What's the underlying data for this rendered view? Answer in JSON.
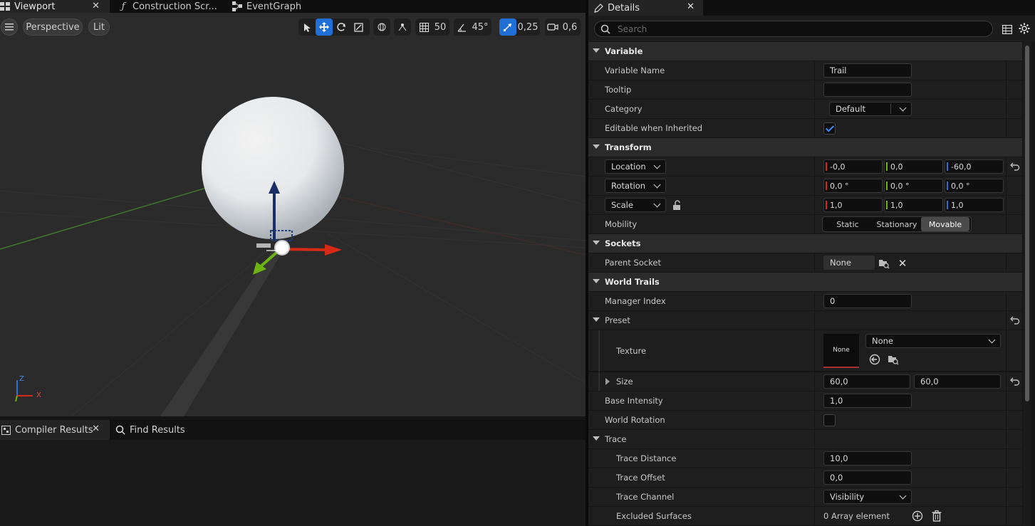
{
  "editor_tabs": [
    {
      "label": "Viewport",
      "active": true
    },
    {
      "label": "Construction Scr..."
    },
    {
      "label": "EventGraph"
    }
  ],
  "viewport_toolbar": {
    "view_mode": "Perspective",
    "lighting": "Lit",
    "grid_snap": "50",
    "rotation_snap": "45°",
    "scale_snap": "0,25",
    "camera_speed": "0,6"
  },
  "bottom_tabs": [
    {
      "label": "Compiler Results",
      "active": true
    },
    {
      "label": "Find Results"
    }
  ],
  "details": {
    "tab_label": "Details",
    "search_placeholder": "Search",
    "rows": {
      "variable": "Variable",
      "variable_name": {
        "label": "Variable Name",
        "value": "Trail"
      },
      "tooltip": {
        "label": "Tooltip",
        "value": ""
      },
      "category": {
        "label": "Category",
        "value": "Default"
      },
      "editable": {
        "label": "Editable when Inherited",
        "checked": true
      },
      "transform": "Transform",
      "location": {
        "label": "Location",
        "x": "-0,0",
        "y": "0,0",
        "z": "-60,0"
      },
      "rotation": {
        "label": "Rotation",
        "x": "0,0 °",
        "y": "0,0 °",
        "z": "0,0 °"
      },
      "scale": {
        "label": "Scale",
        "x": "1,0",
        "y": "1,0",
        "z": "1,0"
      },
      "mobility": {
        "label": "Mobility",
        "options": [
          "Static",
          "Stationary",
          "Movable"
        ],
        "selected": "Movable"
      },
      "sockets": "Sockets",
      "parent_socket": {
        "label": "Parent Socket",
        "value": "None"
      },
      "world_trails": "World Trails",
      "manager_index": {
        "label": "Manager Index",
        "value": "0"
      },
      "preset": "Preset",
      "texture": {
        "label": "Texture",
        "thumb": "None",
        "value": "None"
      },
      "size": {
        "label": "Size",
        "x": "60,0",
        "y": "60,0"
      },
      "base_intensity": {
        "label": "Base Intensity",
        "value": "1,0"
      },
      "world_rotation": {
        "label": "World Rotation",
        "checked": false
      },
      "trace": "Trace",
      "trace_distance": {
        "label": "Trace Distance",
        "value": "10,0"
      },
      "trace_offset": {
        "label": "Trace Offset",
        "value": "0,0"
      },
      "trace_channel": {
        "label": "Trace Channel",
        "value": "Visibility"
      },
      "excluded_surfaces": {
        "label": "Excluded Surfaces",
        "value": "0 Array element"
      }
    }
  },
  "axis_gizmo": {
    "z": "Z",
    "x": "X"
  },
  "colors": {
    "accent": "#1f6fd6",
    "axis_x": "#d62a16",
    "axis_y": "#6cb314",
    "axis_z": "#2f6fd6"
  }
}
